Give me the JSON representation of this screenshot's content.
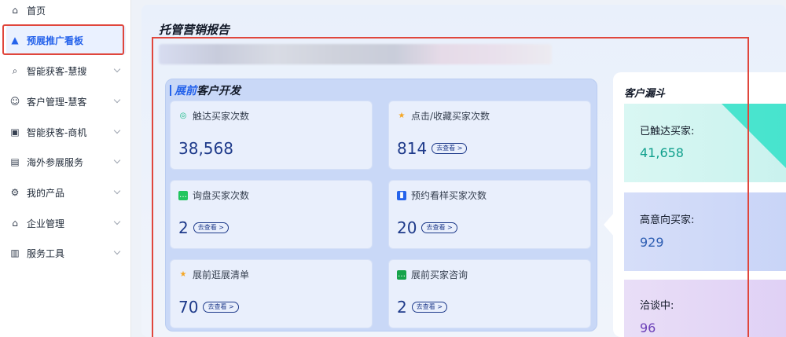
{
  "sidebar": {
    "items": [
      {
        "label": "首页",
        "icon": "home-icon",
        "glyph": "⌂"
      },
      {
        "label": "预展推广看板",
        "icon": "dashboard-icon",
        "glyph": "▲"
      },
      {
        "label": "智能获客-慧搜",
        "icon": "search-icon",
        "glyph": "⌕"
      },
      {
        "label": "客户管理-慧客",
        "icon": "user-icon",
        "glyph": "☺"
      },
      {
        "label": "智能获客-商机",
        "icon": "opportunity-icon",
        "glyph": "▣"
      },
      {
        "label": "海外参展服务",
        "icon": "document-icon",
        "glyph": "▤"
      },
      {
        "label": "我的产品",
        "icon": "product-icon",
        "glyph": "⚙"
      },
      {
        "label": "企业管理",
        "icon": "building-icon",
        "glyph": "⌂"
      },
      {
        "label": "服务工具",
        "icon": "toolbox-icon",
        "glyph": "▥"
      }
    ]
  },
  "main": {
    "title": "托管营销报告"
  },
  "dev": {
    "title_prefix": "展前",
    "title_suffix": "客户开发",
    "go_label": "去查看 >",
    "cards": [
      {
        "label": "触达买家次数",
        "value": "38,568",
        "icon": "touch-icon",
        "glyph": "◎"
      },
      {
        "label": "点击/收藏买家次数",
        "value": "814",
        "icon": "star-icon",
        "glyph": "★"
      },
      {
        "label": "询盘买家次数",
        "value": "2",
        "icon": "message-icon",
        "glyph": "…"
      },
      {
        "label": "预约看样买家次数",
        "value": "20",
        "icon": "bag-icon",
        "glyph": "▮"
      },
      {
        "label": "展前逛展清单",
        "value": "70",
        "icon": "star-icon",
        "glyph": "★"
      },
      {
        "label": "展前买家咨询",
        "value": "2",
        "icon": "chat-icon",
        "glyph": "…"
      }
    ]
  },
  "funnel": {
    "title": "客户漏斗",
    "tiers": [
      {
        "label": "已触达买家:",
        "value": "41,658",
        "color": "#0f9f8c"
      },
      {
        "label": "高意向买家:",
        "value": "929",
        "color": "#2f5fb3"
      },
      {
        "label": "洽谈中:",
        "value": "96",
        "color": "#6b3fb8"
      }
    ]
  },
  "colors": {
    "accent": "#2563eb",
    "highlight_border": "#e0463c"
  }
}
